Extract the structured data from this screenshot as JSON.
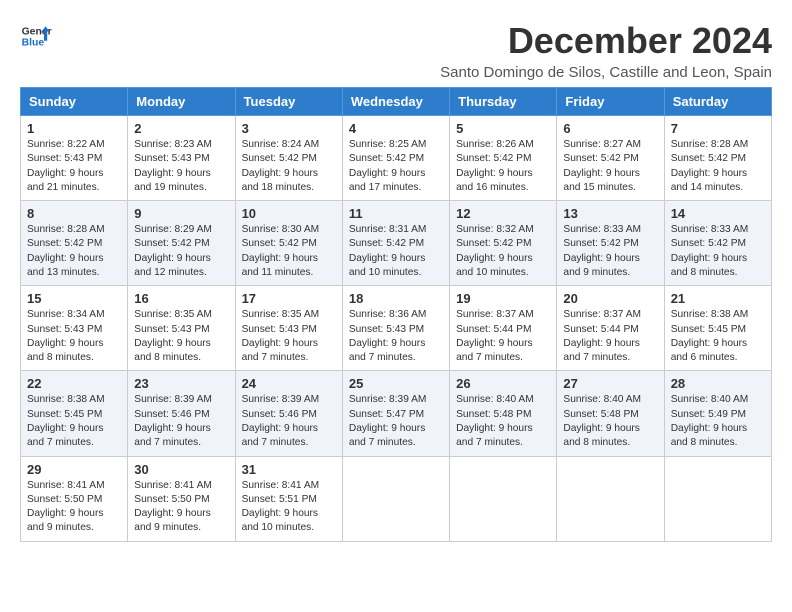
{
  "header": {
    "logo_line1": "General",
    "logo_line2": "Blue",
    "title": "December 2024",
    "subtitle": "Santo Domingo de Silos, Castille and Leon, Spain"
  },
  "weekdays": [
    "Sunday",
    "Monday",
    "Tuesday",
    "Wednesday",
    "Thursday",
    "Friday",
    "Saturday"
  ],
  "weeks": [
    [
      {
        "day": "1",
        "sunrise": "Sunrise: 8:22 AM",
        "sunset": "Sunset: 5:43 PM",
        "daylight": "Daylight: 9 hours and 21 minutes."
      },
      {
        "day": "2",
        "sunrise": "Sunrise: 8:23 AM",
        "sunset": "Sunset: 5:43 PM",
        "daylight": "Daylight: 9 hours and 19 minutes."
      },
      {
        "day": "3",
        "sunrise": "Sunrise: 8:24 AM",
        "sunset": "Sunset: 5:42 PM",
        "daylight": "Daylight: 9 hours and 18 minutes."
      },
      {
        "day": "4",
        "sunrise": "Sunrise: 8:25 AM",
        "sunset": "Sunset: 5:42 PM",
        "daylight": "Daylight: 9 hours and 17 minutes."
      },
      {
        "day": "5",
        "sunrise": "Sunrise: 8:26 AM",
        "sunset": "Sunset: 5:42 PM",
        "daylight": "Daylight: 9 hours and 16 minutes."
      },
      {
        "day": "6",
        "sunrise": "Sunrise: 8:27 AM",
        "sunset": "Sunset: 5:42 PM",
        "daylight": "Daylight: 9 hours and 15 minutes."
      },
      {
        "day": "7",
        "sunrise": "Sunrise: 8:28 AM",
        "sunset": "Sunset: 5:42 PM",
        "daylight": "Daylight: 9 hours and 14 minutes."
      }
    ],
    [
      {
        "day": "8",
        "sunrise": "Sunrise: 8:28 AM",
        "sunset": "Sunset: 5:42 PM",
        "daylight": "Daylight: 9 hours and 13 minutes."
      },
      {
        "day": "9",
        "sunrise": "Sunrise: 8:29 AM",
        "sunset": "Sunset: 5:42 PM",
        "daylight": "Daylight: 9 hours and 12 minutes."
      },
      {
        "day": "10",
        "sunrise": "Sunrise: 8:30 AM",
        "sunset": "Sunset: 5:42 PM",
        "daylight": "Daylight: 9 hours and 11 minutes."
      },
      {
        "day": "11",
        "sunrise": "Sunrise: 8:31 AM",
        "sunset": "Sunset: 5:42 PM",
        "daylight": "Daylight: 9 hours and 10 minutes."
      },
      {
        "day": "12",
        "sunrise": "Sunrise: 8:32 AM",
        "sunset": "Sunset: 5:42 PM",
        "daylight": "Daylight: 9 hours and 10 minutes."
      },
      {
        "day": "13",
        "sunrise": "Sunrise: 8:33 AM",
        "sunset": "Sunset: 5:42 PM",
        "daylight": "Daylight: 9 hours and 9 minutes."
      },
      {
        "day": "14",
        "sunrise": "Sunrise: 8:33 AM",
        "sunset": "Sunset: 5:42 PM",
        "daylight": "Daylight: 9 hours and 8 minutes."
      }
    ],
    [
      {
        "day": "15",
        "sunrise": "Sunrise: 8:34 AM",
        "sunset": "Sunset: 5:43 PM",
        "daylight": "Daylight: 9 hours and 8 minutes."
      },
      {
        "day": "16",
        "sunrise": "Sunrise: 8:35 AM",
        "sunset": "Sunset: 5:43 PM",
        "daylight": "Daylight: 9 hours and 8 minutes."
      },
      {
        "day": "17",
        "sunrise": "Sunrise: 8:35 AM",
        "sunset": "Sunset: 5:43 PM",
        "daylight": "Daylight: 9 hours and 7 minutes."
      },
      {
        "day": "18",
        "sunrise": "Sunrise: 8:36 AM",
        "sunset": "Sunset: 5:43 PM",
        "daylight": "Daylight: 9 hours and 7 minutes."
      },
      {
        "day": "19",
        "sunrise": "Sunrise: 8:37 AM",
        "sunset": "Sunset: 5:44 PM",
        "daylight": "Daylight: 9 hours and 7 minutes."
      },
      {
        "day": "20",
        "sunrise": "Sunrise: 8:37 AM",
        "sunset": "Sunset: 5:44 PM",
        "daylight": "Daylight: 9 hours and 7 minutes."
      },
      {
        "day": "21",
        "sunrise": "Sunrise: 8:38 AM",
        "sunset": "Sunset: 5:45 PM",
        "daylight": "Daylight: 9 hours and 6 minutes."
      }
    ],
    [
      {
        "day": "22",
        "sunrise": "Sunrise: 8:38 AM",
        "sunset": "Sunset: 5:45 PM",
        "daylight": "Daylight: 9 hours and 7 minutes."
      },
      {
        "day": "23",
        "sunrise": "Sunrise: 8:39 AM",
        "sunset": "Sunset: 5:46 PM",
        "daylight": "Daylight: 9 hours and 7 minutes."
      },
      {
        "day": "24",
        "sunrise": "Sunrise: 8:39 AM",
        "sunset": "Sunset: 5:46 PM",
        "daylight": "Daylight: 9 hours and 7 minutes."
      },
      {
        "day": "25",
        "sunrise": "Sunrise: 8:39 AM",
        "sunset": "Sunset: 5:47 PM",
        "daylight": "Daylight: 9 hours and 7 minutes."
      },
      {
        "day": "26",
        "sunrise": "Sunrise: 8:40 AM",
        "sunset": "Sunset: 5:48 PM",
        "daylight": "Daylight: 9 hours and 7 minutes."
      },
      {
        "day": "27",
        "sunrise": "Sunrise: 8:40 AM",
        "sunset": "Sunset: 5:48 PM",
        "daylight": "Daylight: 9 hours and 8 minutes."
      },
      {
        "day": "28",
        "sunrise": "Sunrise: 8:40 AM",
        "sunset": "Sunset: 5:49 PM",
        "daylight": "Daylight: 9 hours and 8 minutes."
      }
    ],
    [
      {
        "day": "29",
        "sunrise": "Sunrise: 8:41 AM",
        "sunset": "Sunset: 5:50 PM",
        "daylight": "Daylight: 9 hours and 9 minutes."
      },
      {
        "day": "30",
        "sunrise": "Sunrise: 8:41 AM",
        "sunset": "Sunset: 5:50 PM",
        "daylight": "Daylight: 9 hours and 9 minutes."
      },
      {
        "day": "31",
        "sunrise": "Sunrise: 8:41 AM",
        "sunset": "Sunset: 5:51 PM",
        "daylight": "Daylight: 9 hours and 10 minutes."
      },
      null,
      null,
      null,
      null
    ]
  ]
}
